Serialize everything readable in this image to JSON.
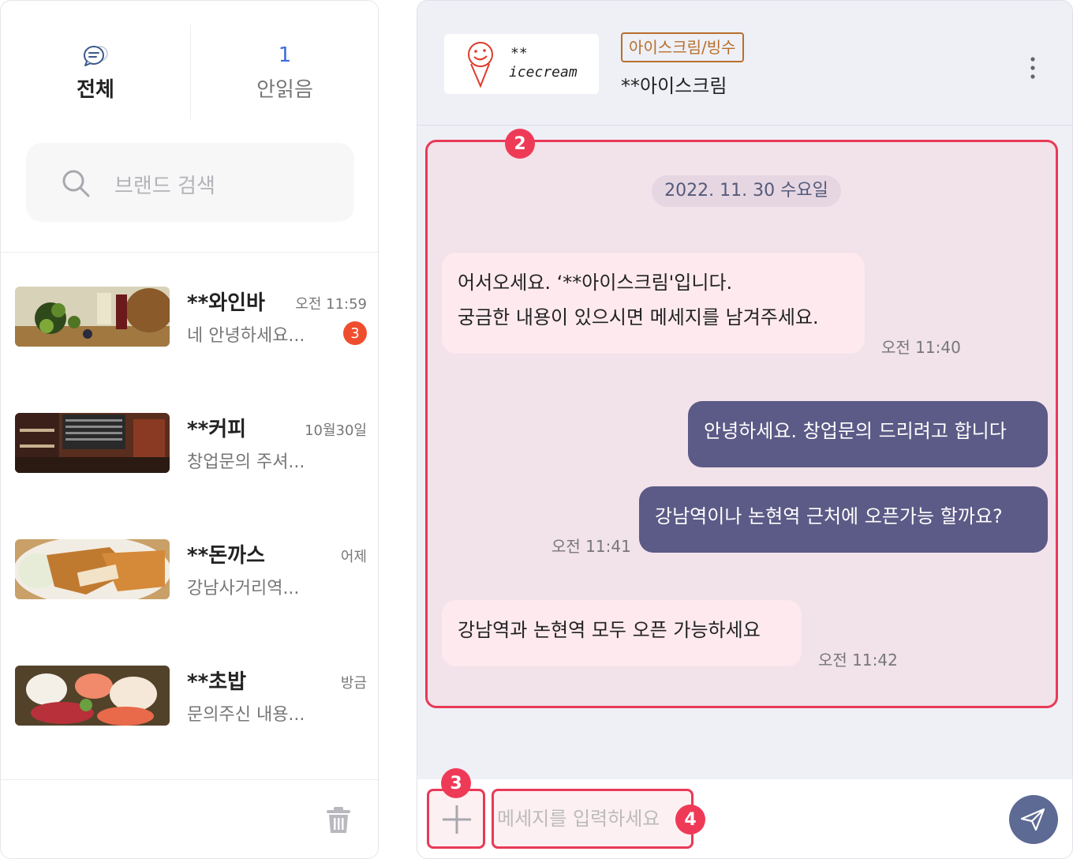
{
  "tabs": {
    "all_label": "전체",
    "unread_count": "1",
    "unread_label": "안읽음"
  },
  "search": {
    "placeholder": "브랜드 검색"
  },
  "conversations": [
    {
      "name": "**와인바",
      "time": "오전 11:59",
      "preview": "네 안녕하세요...",
      "badge": "3"
    },
    {
      "name": "**커피",
      "time": "10월30일",
      "preview": "창업문의 주셔..."
    },
    {
      "name": "**돈까스",
      "time": "어제",
      "preview": "강남사거리역..."
    },
    {
      "name": "**초밥",
      "time": "방금",
      "preview": "문의주신 내용..."
    }
  ],
  "header": {
    "logo_stars": "**",
    "logo_text": "icecream",
    "category": "아이스크림/빙수",
    "shop_name": "**아이스크림"
  },
  "chat": {
    "date": "2022. 11. 30 수요일",
    "messages": [
      {
        "dir": "in",
        "line1": "어서오세요. ‘**아이스크림'입니다.",
        "line2": "궁금한 내용이 있으시면 메세지를 남겨주세요.",
        "time": "오전 11:40"
      },
      {
        "dir": "out",
        "text": "안녕하세요. 창업문의 드리려고 합니다"
      },
      {
        "dir": "out",
        "text": "강남역이나 논현역 근처에 오픈가능 할까요?",
        "time": "오전 11:41"
      },
      {
        "dir": "in",
        "text": "강남역과 논현역 모두 오픈 가능하세요",
        "time": "오전 11:42"
      }
    ]
  },
  "composer": {
    "placeholder": "메세지를 입력하세요"
  },
  "markers": {
    "m2": "2",
    "m3": "3",
    "m4": "4"
  },
  "colors": {
    "accent": "#5c5a86",
    "highlight": "#e83a57",
    "badge": "#ef4e2e",
    "link": "#3a6fd8"
  }
}
